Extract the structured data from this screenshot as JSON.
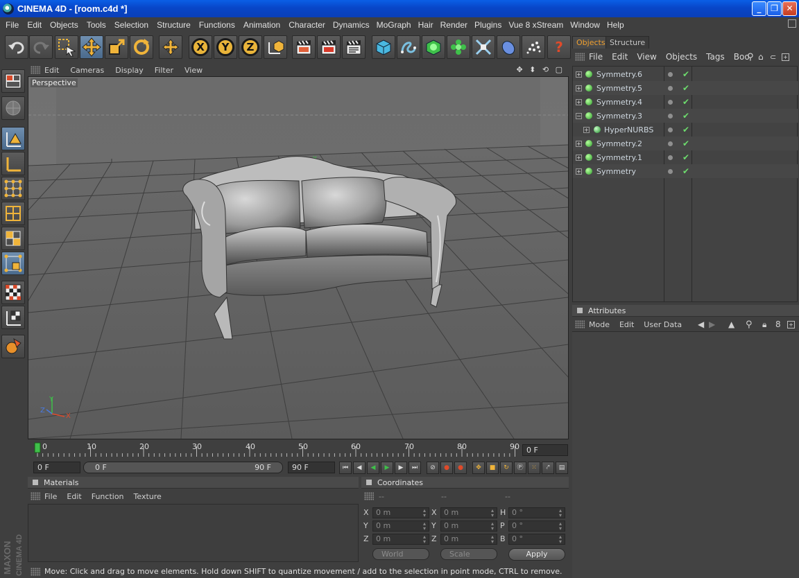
{
  "window": {
    "title": "CINEMA 4D - [room.c4d *]",
    "minimize_label": "_",
    "maximize_label": "❐",
    "close_label": "✕"
  },
  "menubar": [
    "File",
    "Edit",
    "Objects",
    "Tools",
    "Selection",
    "Structure",
    "Functions",
    "Animation",
    "Character",
    "Dynamics",
    "MoGraph",
    "Hair",
    "Render",
    "Plugins",
    "Vue 8 xStream",
    "Window",
    "Help"
  ],
  "toolbar": {
    "x_label": "X",
    "y_label": "Y",
    "z_label": "Z",
    "help_label": "?"
  },
  "viewport": {
    "menu": [
      "Edit",
      "Cameras",
      "Display",
      "Filter",
      "View"
    ],
    "label": "Perspective",
    "axis_y": "Y",
    "axis_x": "X",
    "axis_z": "Z",
    "nav_controls": "✥ ⬍ ⟲ ▢"
  },
  "timeline": {
    "ticks": [
      "0",
      "10",
      "20",
      "30",
      "40",
      "50",
      "60",
      "70",
      "80",
      "90"
    ],
    "current_frame": "0 F",
    "start_field": "0 F",
    "range_start": "0 F",
    "range_end": "90 F",
    "end_field": "90 F"
  },
  "materials": {
    "title": "Materials",
    "menu": [
      "File",
      "Edit",
      "Function",
      "Texture"
    ]
  },
  "coordinates": {
    "title": "Coordinates",
    "col_headers": [
      "--",
      "--",
      "--"
    ],
    "labels_pos": [
      "X",
      "Y",
      "Z"
    ],
    "labels_size": [
      "X",
      "Y",
      "Z"
    ],
    "labels_rot": [
      "H",
      "P",
      "B"
    ],
    "pos_values": [
      "0 m",
      "0 m",
      "0 m"
    ],
    "size_values": [
      "0 m",
      "0 m",
      "0 m"
    ],
    "rot_values": [
      "0 °",
      "0 °",
      "0 °"
    ],
    "mode_world": "World",
    "mode_scale": "Scale",
    "apply_label": "Apply"
  },
  "status": "Move: Click and drag to move elements. Hold down SHIFT to quantize movement / add to the selection in point mode, CTRL to remove.",
  "object_manager": {
    "tabs": [
      "Objects",
      "Structure"
    ],
    "menu": [
      "File",
      "Edit",
      "View",
      "Objects",
      "Tags",
      "Boo"
    ],
    "rows": [
      {
        "name": "Symmetry.6",
        "indent": 0
      },
      {
        "name": "Symmetry.5",
        "indent": 0
      },
      {
        "name": "Symmetry.4",
        "indent": 0
      },
      {
        "name": "Symmetry.3",
        "indent": 0
      },
      {
        "name": "HyperNURBS",
        "indent": 1
      },
      {
        "name": "Symmetry.2",
        "indent": 0
      },
      {
        "name": "Symmetry.1",
        "indent": 0
      },
      {
        "name": "Symmetry",
        "indent": 0
      }
    ]
  },
  "attributes": {
    "title": "Attributes",
    "menu": [
      "Mode",
      "Edit",
      "User Data"
    ]
  },
  "logo": {
    "line1": "MAXON",
    "line2": "CINEMA 4D"
  },
  "colors": {
    "accent": "#e9b43a",
    "active_tab": "#f0a030",
    "check": "#6ddc6d"
  }
}
